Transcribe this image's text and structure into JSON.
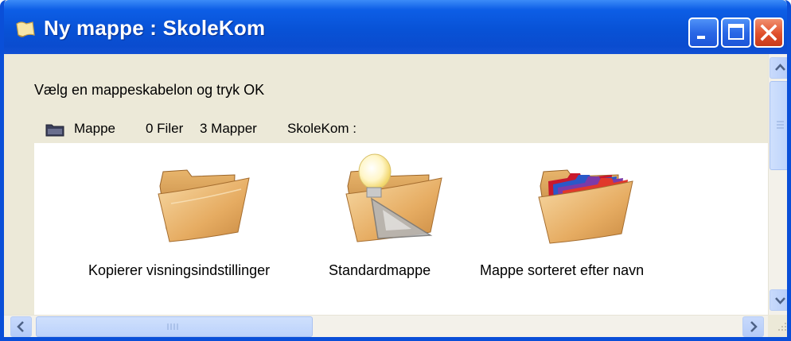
{
  "window": {
    "title": "Ny mappe : SkoleKom",
    "title_icon": "folder-scroll-icon",
    "buttons": {
      "minimize": "minimize-icon",
      "maximize": "maximize-icon",
      "close": "close-icon"
    }
  },
  "content": {
    "instruction": "Vælg en mappeskabelon og tryk OK",
    "pathbar": {
      "icon": "folder-icon",
      "type_label": "Mappe",
      "files": "0 Filer",
      "folders": "3 Mapper",
      "location": "SkoleKom :"
    },
    "templates": [
      {
        "label": "Kopierer visningsindstillinger",
        "icon": "plain-folder-icon"
      },
      {
        "label": "Standardmappe",
        "icon": "lightbulb-folder-icon"
      },
      {
        "label": "Mappe sorteret efter navn",
        "icon": "colored-files-folder-icon"
      }
    ]
  },
  "colors": {
    "titlebar": "#0a4fd8",
    "close_button": "#e0502c",
    "scrollbar": "#c1d3fb"
  }
}
